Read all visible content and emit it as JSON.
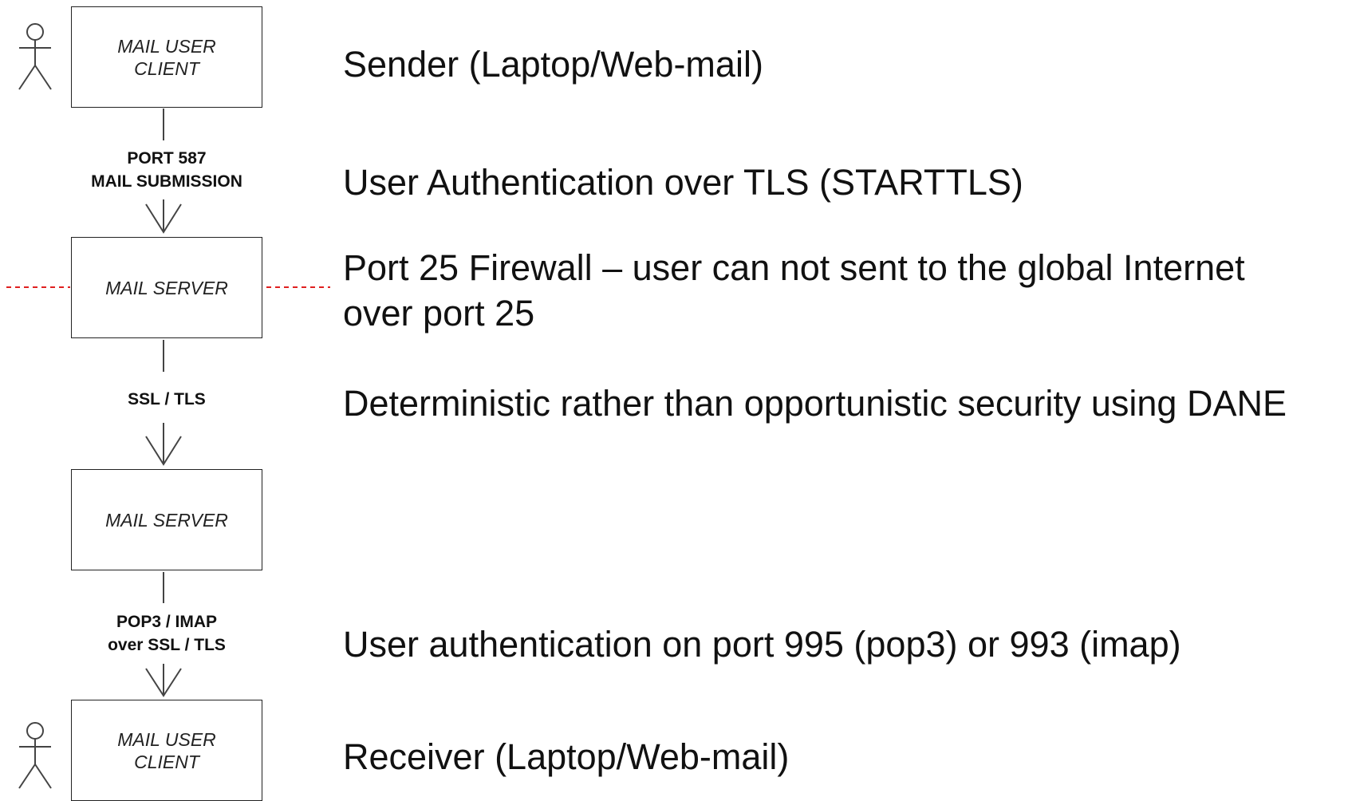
{
  "diagram": {
    "nodes": [
      {
        "id": "sender-client",
        "label": "MAIL USER\nCLIENT",
        "actor": true
      },
      {
        "id": "sender-server",
        "label": "MAIL SERVER",
        "actor": false
      },
      {
        "id": "receiver-server",
        "label": "MAIL SERVER",
        "actor": false
      },
      {
        "id": "receiver-client",
        "label": "MAIL USER\nCLIENT",
        "actor": true
      }
    ],
    "edges": [
      {
        "from": "sender-client",
        "to": "sender-server",
        "label": "PORT 587\nMAIL SUBMISSION"
      },
      {
        "from": "sender-server",
        "to": "receiver-server",
        "label": "SSL / TLS"
      },
      {
        "from": "receiver-server",
        "to": "receiver-client",
        "label": "POP3 / IMAP\nover SSL / TLS"
      }
    ],
    "firewall_line_color": "#e02020"
  },
  "notes": {
    "sender": "Sender (Laptop/Web-mail)",
    "submission": "User Authentication over TLS (STARTTLS)",
    "firewall_line1": "Port 25 Firewall – user can not sent to the global Internet",
    "firewall_line2": "over port 25",
    "dane": "Deterministic rather than opportunistic security using DANE",
    "retrieval": "User authentication on port 995 (pop3) or 993 (imap)",
    "receiver": "Receiver (Laptop/Web-mail)"
  }
}
